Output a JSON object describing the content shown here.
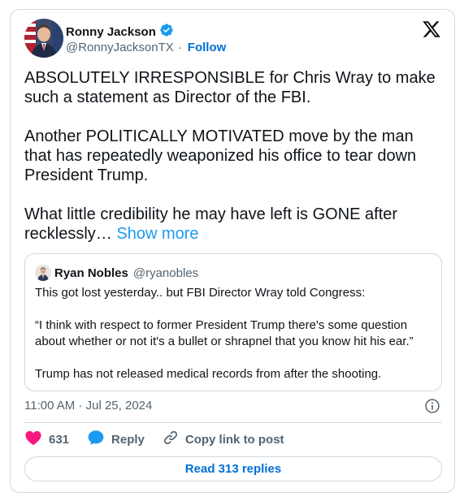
{
  "author": {
    "name": "Ronny Jackson",
    "handle": "@RonnyJacksonTX",
    "follow_label": "Follow",
    "separator": "·"
  },
  "tweet": {
    "paragraphs": [
      "ABSOLUTELY IRRESPONSIBLE for Chris Wray to make such a statement as Director of the FBI.",
      "Another POLITICALLY MOTIVATED move by the man that has repeatedly weaponized his office to tear down President Trump.",
      "What little credibility he may have left is GONE after recklessly…"
    ],
    "show_more": "Show more"
  },
  "quote": {
    "name": "Ryan Nobles",
    "handle": "@ryanobles",
    "paragraphs": [
      "This got lost yesterday.. but FBI Director Wray told Congress:",
      "“I think with respect to former President Trump there's some question about whether or not it's a bullet or shrapnel that you know hit his ear.”",
      "Trump has not released medical records from after the shooting."
    ]
  },
  "meta": {
    "time": "11:00 AM",
    "separator": "·",
    "date": "Jul 25, 2024"
  },
  "actions": {
    "likes": "631",
    "reply_label": "Reply",
    "copy_label": "Copy link to post",
    "read_replies": "Read 313 replies"
  },
  "colors": {
    "like": "#f91880",
    "reply": "#1d9bf0",
    "link": "#006fd6",
    "verified": "#1d9bf0"
  },
  "icons": [
    "verified-badge-icon",
    "x-logo-icon",
    "info-icon",
    "heart-icon",
    "reply-bubble-icon",
    "link-icon"
  ]
}
